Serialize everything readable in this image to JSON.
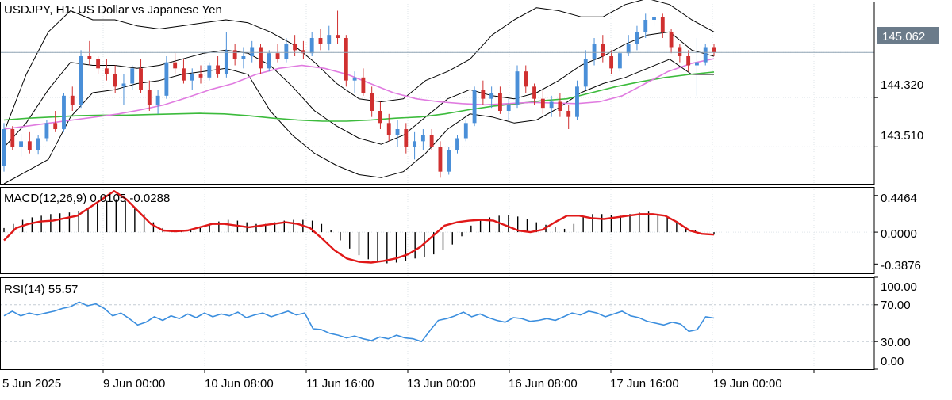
{
  "chart_data": [
    {
      "type": "candlestick",
      "panel": "price",
      "title": "USDJPY, H1:  US Dollar vs Japanese Yen",
      "y_ticks": [
        "144.320",
        "143.510"
      ],
      "ylim": [
        142.9,
        145.9
      ],
      "current_price": "145.062",
      "current_price_value": 145.062,
      "ohlc": [
        [
          143.2,
          143.9,
          143.1,
          143.8
        ],
        [
          143.8,
          143.85,
          143.45,
          143.5
        ],
        [
          143.5,
          143.72,
          143.35,
          143.6
        ],
        [
          143.6,
          143.75,
          143.4,
          143.45
        ],
        [
          143.45,
          143.7,
          143.38,
          143.65
        ],
        [
          143.65,
          143.95,
          143.6,
          143.9
        ],
        [
          143.9,
          144.1,
          143.75,
          143.8
        ],
        [
          143.8,
          144.4,
          143.75,
          144.35
        ],
        [
          144.35,
          144.5,
          144.1,
          144.2
        ],
        [
          144.2,
          145.1,
          144.15,
          145.0
        ],
        [
          145.0,
          145.25,
          144.85,
          144.95
        ],
        [
          144.95,
          145.0,
          144.7,
          144.8
        ],
        [
          144.8,
          144.95,
          144.6,
          144.7
        ],
        [
          144.7,
          144.85,
          144.4,
          144.5
        ],
        [
          144.5,
          144.7,
          144.2,
          144.55
        ],
        [
          144.55,
          144.85,
          144.45,
          144.8
        ],
        [
          144.8,
          144.95,
          144.4,
          144.45
        ],
        [
          144.45,
          144.6,
          144.1,
          144.2
        ],
        [
          144.2,
          144.45,
          144.05,
          144.35
        ],
        [
          144.35,
          145.0,
          144.3,
          144.9
        ],
        [
          144.9,
          145.05,
          144.7,
          144.8
        ],
        [
          144.8,
          144.95,
          144.55,
          144.6
        ],
        [
          144.6,
          144.8,
          144.45,
          144.7
        ],
        [
          144.7,
          144.85,
          144.55,
          144.65
        ],
        [
          144.65,
          144.9,
          144.6,
          144.85
        ],
        [
          144.85,
          145.0,
          144.65,
          144.7
        ],
        [
          144.7,
          145.4,
          144.65,
          145.1
        ],
        [
          145.1,
          145.2,
          144.85,
          144.95
        ],
        [
          144.95,
          145.15,
          144.8,
          145.0
        ],
        [
          145.0,
          145.25,
          144.9,
          145.15
        ],
        [
          145.15,
          145.2,
          144.7,
          144.8
        ],
        [
          144.8,
          145.1,
          144.75,
          145.05
        ],
        [
          145.05,
          145.2,
          144.9,
          144.95
        ],
        [
          144.95,
          145.3,
          144.9,
          145.2
        ],
        [
          145.2,
          145.35,
          145.0,
          145.1
        ],
        [
          145.1,
          145.25,
          144.95,
          145.05
        ],
        [
          145.05,
          145.4,
          145.0,
          145.3
        ],
        [
          145.3,
          145.45,
          145.1,
          145.2
        ],
        [
          145.2,
          145.5,
          145.1,
          145.35
        ],
        [
          145.35,
          145.75,
          145.2,
          145.3
        ],
        [
          145.3,
          145.35,
          144.5,
          144.6
        ],
        [
          144.6,
          144.75,
          144.4,
          144.65
        ],
        [
          144.65,
          144.8,
          144.35,
          144.4
        ],
        [
          144.4,
          144.5,
          144.0,
          144.1
        ],
        [
          144.1,
          144.25,
          143.8,
          143.9
        ],
        [
          143.9,
          144.05,
          143.6,
          143.7
        ],
        [
          143.7,
          143.95,
          143.5,
          143.8
        ],
        [
          143.8,
          143.9,
          143.4,
          143.5
        ],
        [
          143.5,
          143.75,
          143.3,
          143.6
        ],
        [
          143.6,
          143.8,
          143.45,
          143.7
        ],
        [
          143.7,
          143.8,
          143.45,
          143.5
        ],
        [
          143.5,
          143.6,
          143.0,
          143.1
        ],
        [
          143.1,
          143.5,
          143.05,
          143.45
        ],
        [
          143.45,
          143.7,
          143.4,
          143.65
        ],
        [
          143.65,
          143.95,
          143.6,
          143.9
        ],
        [
          143.9,
          144.5,
          143.85,
          144.45
        ],
        [
          144.45,
          144.6,
          144.2,
          144.3
        ],
        [
          144.3,
          144.5,
          144.15,
          144.4
        ],
        [
          144.4,
          144.5,
          144.05,
          144.1
        ],
        [
          144.1,
          144.3,
          143.95,
          144.2
        ],
        [
          144.2,
          144.85,
          144.15,
          144.75
        ],
        [
          144.75,
          144.85,
          144.4,
          144.5
        ],
        [
          144.5,
          144.55,
          144.2,
          144.3
        ],
        [
          144.3,
          144.45,
          144.05,
          144.15
        ],
        [
          144.15,
          144.35,
          144.0,
          144.25
        ],
        [
          144.25,
          144.4,
          144.0,
          144.1
        ],
        [
          144.1,
          144.2,
          143.8,
          144.0
        ],
        [
          144.0,
          144.6,
          143.95,
          144.5
        ],
        [
          144.5,
          145.1,
          144.45,
          144.95
        ],
        [
          144.95,
          145.3,
          144.85,
          145.2
        ],
        [
          145.2,
          145.35,
          144.9,
          145.0
        ],
        [
          145.0,
          145.1,
          144.7,
          144.8
        ],
        [
          144.8,
          145.1,
          144.75,
          145.05
        ],
        [
          145.05,
          145.35,
          145.0,
          145.2
        ],
        [
          145.2,
          145.5,
          145.1,
          145.4
        ],
        [
          145.4,
          145.7,
          145.3,
          145.6
        ],
        [
          145.6,
          145.75,
          145.5,
          145.65
        ],
        [
          145.65,
          145.7,
          145.3,
          145.4
        ],
        [
          145.4,
          145.45,
          145.05,
          145.15
        ],
        [
          145.15,
          145.2,
          144.9,
          145.0
        ],
        [
          145.0,
          145.1,
          144.75,
          144.85
        ],
        [
          144.85,
          145.3,
          144.35,
          144.9
        ],
        [
          144.9,
          145.2,
          144.85,
          145.15
        ],
        [
          145.15,
          145.2,
          145.0,
          145.06
        ]
      ],
      "indicators": [
        {
          "name": "Bollinger Bands",
          "upper": [
            143.75,
            144.7,
            145.4,
            145.75,
            145.6,
            145.6,
            145.5,
            145.45,
            145.5,
            145.55,
            145.6,
            145.55,
            145.4,
            145.2,
            144.9,
            144.55,
            144.3,
            144.25,
            144.3,
            144.6,
            144.75,
            144.95,
            145.35,
            145.6,
            145.8,
            145.75,
            145.65,
            145.65,
            145.85,
            145.95,
            145.85,
            145.6,
            145.4
          ],
          "middle": [
            143.5,
            143.9,
            144.45,
            144.9,
            144.85,
            144.85,
            144.8,
            144.85,
            144.95,
            145.05,
            145.1,
            145.05,
            144.85,
            144.5,
            144.1,
            143.85,
            143.65,
            143.55,
            143.7,
            144.0,
            144.3,
            144.45,
            144.35,
            144.3,
            144.4,
            144.6,
            144.85,
            145.0,
            145.2,
            145.35,
            145.4,
            145.1,
            145.0
          ],
          "lower": [
            142.9,
            143.1,
            143.3,
            144.0,
            144.4,
            144.45,
            144.55,
            144.6,
            144.7,
            144.75,
            144.8,
            144.7,
            144.1,
            143.7,
            143.4,
            143.2,
            143.05,
            143.0,
            143.1,
            143.4,
            143.8,
            144.05,
            144.0,
            143.9,
            143.95,
            144.15,
            144.4,
            144.55,
            144.65,
            144.8,
            144.95,
            144.7,
            144.7
          ]
        },
        {
          "name": "MA slow",
          "values": [
            143.95,
            143.98,
            144.0,
            144.02,
            144.03,
            144.03,
            144.04,
            144.05,
            144.06,
            144.05,
            144.02,
            143.98,
            143.95,
            143.93,
            143.93,
            143.95,
            143.98,
            144.0,
            144.05,
            144.12,
            144.18,
            144.22,
            144.27,
            144.3,
            144.4,
            144.5,
            144.58,
            144.65,
            144.7,
            144.74
          ]
        },
        {
          "name": "MA fast",
          "values": [
            143.8,
            143.85,
            143.9,
            143.95,
            144.0,
            144.05,
            144.12,
            144.2,
            144.32,
            144.45,
            144.55,
            144.7,
            144.8,
            144.85,
            144.8,
            144.7,
            144.55,
            144.4,
            144.3,
            144.25,
            144.22,
            144.2,
            144.22,
            144.24,
            144.23,
            144.22,
            144.25,
            144.35,
            144.55,
            144.75,
            144.88,
            144.96
          ]
        }
      ],
      "x_ticks": [
        "5 Jun 2025",
        "9 Jun 00:00",
        "10 Jun 08:00",
        "11 Jun 16:00",
        "13 Jun 00:00",
        "16 Jun 08:00",
        "17 Jun 16:00",
        "19 Jun 00:00"
      ]
    },
    {
      "type": "bar",
      "panel": "macd",
      "title": "MACD(12,26,9) 0.0105 -0.0288",
      "y_ticks": [
        "0.4464",
        "0.0000",
        "-0.3876"
      ],
      "ylim": [
        -0.5,
        0.55
      ],
      "histogram": [
        0.05,
        0.1,
        0.15,
        0.18,
        0.2,
        0.22,
        0.23,
        0.24,
        0.26,
        0.3,
        0.35,
        0.38,
        0.4,
        0.38,
        0.3,
        0.22,
        0.12,
        0.05,
        0.02,
        0.01,
        0.02,
        0.05,
        0.1,
        0.13,
        0.15,
        0.14,
        0.12,
        0.1,
        0.1,
        0.12,
        0.14,
        0.15,
        0.15,
        0.14,
        0.1,
        0.02,
        -0.1,
        -0.2,
        -0.28,
        -0.33,
        -0.37,
        -0.38,
        -0.37,
        -0.35,
        -0.32,
        -0.3,
        -0.27,
        -0.22,
        -0.15,
        -0.05,
        0.08,
        0.14,
        0.18,
        0.2,
        0.21,
        0.19,
        0.16,
        0.12,
        0.09,
        0.06,
        0.04,
        0.1,
        0.18,
        0.22,
        0.22,
        0.21,
        0.2,
        0.22,
        0.24,
        0.25,
        0.22,
        0.18,
        0.12,
        0.06,
        0.02,
        0.0,
        -0.03
      ],
      "signal": [
        -0.1,
        0.05,
        0.1,
        0.13,
        0.14,
        0.17,
        0.2,
        0.3,
        0.4,
        0.5,
        0.4,
        0.25,
        0.1,
        0.02,
        0.01,
        0.02,
        0.06,
        0.1,
        0.1,
        0.08,
        0.06,
        0.08,
        0.1,
        0.12,
        0.1,
        0.05,
        -0.08,
        -0.22,
        -0.32,
        -0.36,
        -0.37,
        -0.35,
        -0.32,
        -0.27,
        -0.18,
        -0.05,
        0.08,
        0.12,
        0.14,
        0.15,
        0.14,
        0.08,
        0.02,
        0.0,
        0.03,
        0.12,
        0.2,
        0.2,
        0.17,
        0.16,
        0.18,
        0.2,
        0.22,
        0.22,
        0.2,
        0.12,
        0.02,
        -0.02,
        -0.03
      ]
    },
    {
      "type": "line",
      "panel": "rsi",
      "title": "RSI(14) 55.57",
      "y_ticks": [
        "100.00",
        "70.00",
        "30.00",
        "0.00"
      ],
      "levels": [
        70,
        30
      ],
      "ylim": [
        0,
        100
      ],
      "values": [
        58,
        63,
        58,
        61,
        59,
        61,
        63,
        66,
        68,
        73,
        69,
        71,
        66,
        58,
        61,
        55,
        48,
        51,
        57,
        53,
        58,
        55,
        60,
        56,
        61,
        57,
        60,
        58,
        62,
        56,
        59,
        61,
        57,
        60,
        63,
        59,
        61,
        44,
        43,
        39,
        37,
        34,
        36,
        33,
        31,
        35,
        33,
        37,
        34,
        33,
        30,
        42,
        53,
        55,
        58,
        62,
        57,
        60,
        56,
        53,
        51,
        56,
        55,
        52,
        53,
        55,
        53,
        57,
        61,
        59,
        63,
        61,
        57,
        60,
        63,
        58,
        56,
        52,
        50,
        48,
        51,
        49,
        41,
        43,
        57,
        55.57
      ]
    }
  ]
}
